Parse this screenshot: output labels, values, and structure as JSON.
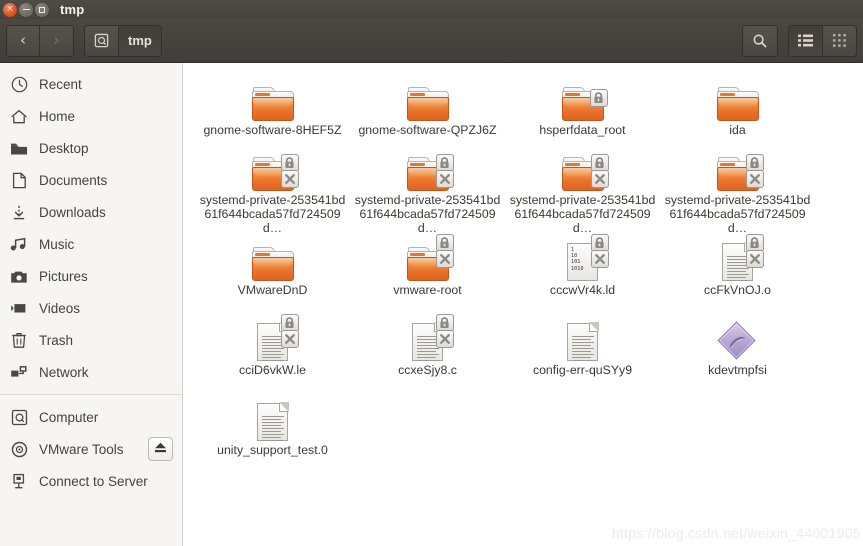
{
  "window": {
    "title": "tmp",
    "controls": [
      {
        "name": "close",
        "glyph": "×"
      },
      {
        "name": "minimize",
        "glyph": ""
      },
      {
        "name": "maximize",
        "glyph": ""
      }
    ]
  },
  "toolbar": {
    "back_label": "‹",
    "forward_label": "›",
    "path_root_icon": "computer-drive-icon",
    "path_segments": [
      "tmp"
    ],
    "search_icon": "search-icon",
    "list_view_icon": "list-view-icon",
    "grid_view_icon": "grid-view-icon"
  },
  "sidebar": {
    "items": [
      {
        "label": "Recent",
        "icon": "clock-icon",
        "eject": false
      },
      {
        "label": "Home",
        "icon": "home-icon",
        "eject": false
      },
      {
        "label": "Desktop",
        "icon": "desktop-icon",
        "eject": false
      },
      {
        "label": "Documents",
        "icon": "document-icon",
        "eject": false
      },
      {
        "label": "Downloads",
        "icon": "download-icon",
        "eject": false
      },
      {
        "label": "Music",
        "icon": "music-note-icon",
        "eject": false
      },
      {
        "label": "Pictures",
        "icon": "camera-icon",
        "eject": false
      },
      {
        "label": "Videos",
        "icon": "video-icon",
        "eject": false
      },
      {
        "label": "Trash",
        "icon": "trash-icon",
        "eject": false
      },
      {
        "label": "Network",
        "icon": "network-icon",
        "eject": false
      }
    ],
    "items2": [
      {
        "label": "Computer",
        "icon": "hard-drive-icon",
        "eject": false
      },
      {
        "label": "VMware Tools",
        "icon": "disc-icon",
        "eject": true
      },
      {
        "label": "Connect to Server",
        "icon": "server-icon",
        "eject": false
      }
    ]
  },
  "files": [
    {
      "name": "gnome-software-8HEF5Z",
      "type": "folder",
      "lock": false,
      "denied": false
    },
    {
      "name": "gnome-software-QPZJ6Z",
      "type": "folder",
      "lock": false,
      "denied": false
    },
    {
      "name": "hsperfdata_root",
      "type": "folder",
      "lock": true,
      "denied": false,
      "lock_low": true
    },
    {
      "name": "ida",
      "type": "folder",
      "lock": false,
      "denied": false
    },
    {
      "name": "systemd-private-253541bd61f644bcada57fd724509d…",
      "type": "folder",
      "lock": true,
      "denied": true
    },
    {
      "name": "systemd-private-253541bd61f644bcada57fd724509d…",
      "type": "folder",
      "lock": true,
      "denied": true
    },
    {
      "name": "systemd-private-253541bd61f644bcada57fd724509d…",
      "type": "folder",
      "lock": true,
      "denied": true
    },
    {
      "name": "systemd-private-253541bd61f644bcada57fd724509d…",
      "type": "folder",
      "lock": true,
      "denied": true
    },
    {
      "name": "VMwareDnD",
      "type": "folder",
      "lock": false,
      "denied": false
    },
    {
      "name": "vmware-root",
      "type": "folder",
      "lock": true,
      "denied": true
    },
    {
      "name": "cccwVr4k.ld",
      "type": "binary",
      "lock": true,
      "denied": true
    },
    {
      "name": "ccFkVnOJ.o",
      "type": "document",
      "lock": true,
      "denied": true
    },
    {
      "name": "cciD6vkW.le",
      "type": "document",
      "lock": true,
      "denied": true
    },
    {
      "name": "ccxeSjy8.c",
      "type": "document",
      "lock": true,
      "denied": true
    },
    {
      "name": "config-err-quSYy9",
      "type": "document",
      "lock": false,
      "denied": false
    },
    {
      "name": "kdevtmpfsi",
      "type": "executable",
      "lock": false,
      "denied": false
    },
    {
      "name": "unity_support_test.0",
      "type": "document",
      "lock": false,
      "denied": false
    }
  ],
  "binary_icon_digits": [
    "1",
    "10",
    "101",
    "1010"
  ],
  "watermark": "https://blog.csdn.net/weixin_44001905",
  "colors": {
    "folder_orange": "#e9712a",
    "titlebar": "#46433e",
    "sidebar_bg": "#f6f5f4",
    "close_button": "#db4818",
    "executable_purple": "#9f8bc4"
  }
}
